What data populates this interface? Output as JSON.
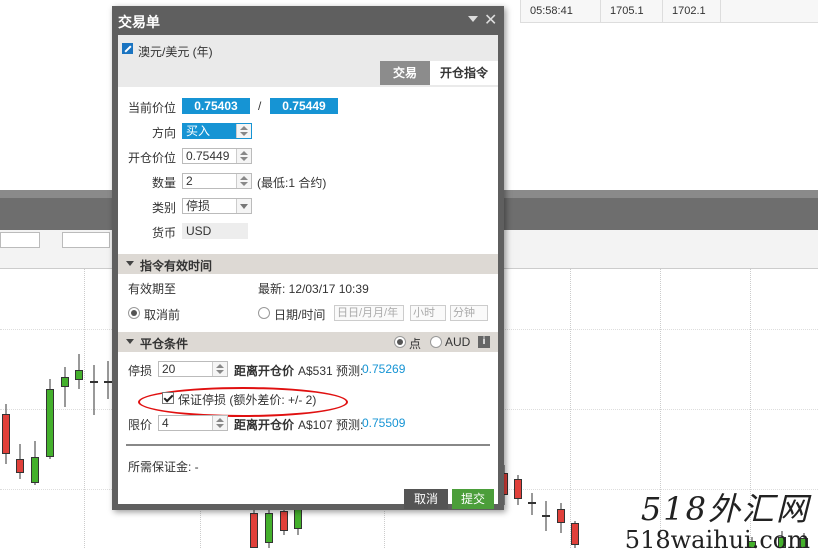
{
  "ticker": {
    "time": "05:58:41",
    "bid": "1705.1",
    "ask": "1702.1"
  },
  "dialog": {
    "title": "交易单",
    "pair": "澳元/美元 (年)",
    "tabs": {
      "trade": "交易",
      "open_order": "开仓指令"
    },
    "current_price_label": "当前价位",
    "bid_price": "0.75403",
    "separator": "/",
    "ask_price": "0.75449",
    "direction_label": "方向",
    "direction_value": "买入",
    "open_price_label": "开仓价位",
    "open_price_value": "0.75449",
    "quantity_label": "数量",
    "quantity_value": "2",
    "quantity_hint": "(最低:1 合约)",
    "type_label": "类别",
    "type_value": "停损",
    "currency_label": "货币",
    "currency_value": "USD",
    "validity_section": "指令有效时间",
    "valid_until_label": "有效期至",
    "latest_label": "最新: 12/03/17 10:39",
    "until_cancel_label": "取消前",
    "datetime_label": "日期/时间",
    "date_placeholder": "日日/月月/年",
    "hour_placeholder": "小时",
    "minute_placeholder": "分钟",
    "close_section": "平仓条件",
    "unit_points": "点",
    "unit_aud": "AUD",
    "stop_label": "停损",
    "stop_value": "20",
    "distance_label": "距离开仓价",
    "stop_amount": "A$531 预测:",
    "stop_forecast": "0.75269",
    "guarantee_label": "保证停损 (额外差价: +/- 2)",
    "limit_label": "限价",
    "limit_value": "4",
    "limit_amount": "A$107 预测:",
    "limit_forecast": "0.75509",
    "margin_label": "所需保证金: -",
    "cancel_button": "取消",
    "submit_button": "提交"
  },
  "watermark": {
    "line1": "518外汇网",
    "line2": "518waihui.com"
  },
  "colors": {
    "accent_blue": "#1694d4",
    "submit_green": "#4b9e3a",
    "candle_green": "#44b02c",
    "candle_red": "#e0403a",
    "oval_red": "#e01010"
  }
}
